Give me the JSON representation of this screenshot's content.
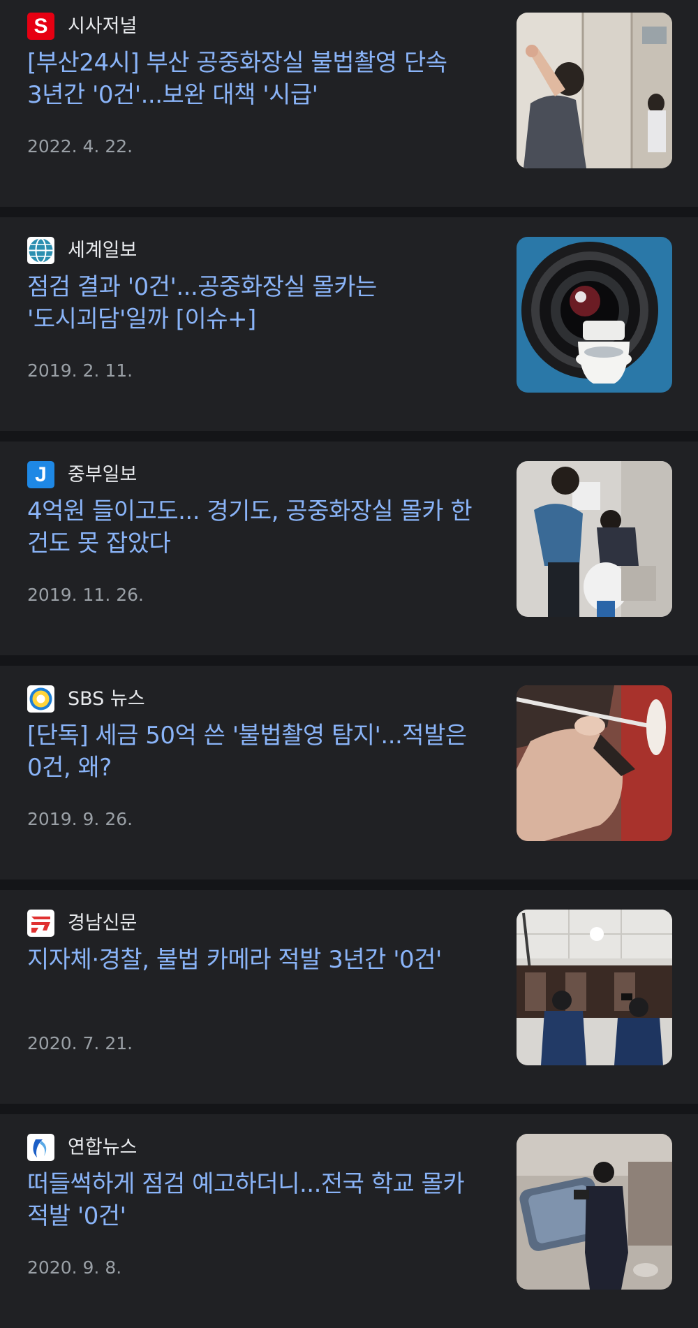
{
  "articles": [
    {
      "source": "시사저널",
      "headline": "[부산24시] 부산 공중화장실 불법촬영 단속 3년간 '0건'...보완 대책 '시급'",
      "date": "2022. 4. 22.",
      "logo": {
        "icon": "sisajournal-s-logo",
        "bg": "#e60012",
        "glyph": "S"
      },
      "thumbnail_icon": "restroom-stall-inspection-photo"
    },
    {
      "source": "세계일보",
      "headline": "점검 결과 '0건'...공중화장실 몰카는 '도시괴담'일까 [이슈+]",
      "date": "2019. 2. 11.",
      "logo": {
        "icon": "segye-globe-logo",
        "bg": "#2b8fb0"
      },
      "thumbnail_icon": "camera-lens-over-toilet-illustration"
    },
    {
      "source": "중부일보",
      "headline": "4억원 들이고도... 경기도, 공중화장실 몰카 한 건도 못 잡았다",
      "date": "2019. 11. 26.",
      "logo": {
        "icon": "joongboo-j-logo",
        "bg": "#1e88e5",
        "glyph": "J"
      },
      "thumbnail_icon": "officers-checking-toilet-photo"
    },
    {
      "source": "SBS 뉴스",
      "headline": "[단독] 세금 50억 쓴 '불법촬영 탐지'...적발은 0건, 왜?",
      "date": "2019. 9. 26.",
      "logo": {
        "icon": "sbs-ring-logo",
        "bg": "#ffffff"
      },
      "thumbnail_icon": "hand-holding-detector-photo"
    },
    {
      "source": "경남신문",
      "headline": "지자체·경찰, 불법 카메라 적발 3년간 '0건'",
      "date": "2020. 7. 21.",
      "logo": {
        "icon": "gyeongnam-red-logo",
        "bg": "#ffffff"
      },
      "thumbnail_icon": "police-inspecting-ceiling-photo"
    },
    {
      "source": "연합뉴스",
      "headline": "떠들썩하게 점검 예고하더니...전국 학교 몰카 적발 '0건'",
      "date": "2020. 9. 8.",
      "logo": {
        "icon": "yonhap-swoosh-logo",
        "bg": "#ffffff"
      },
      "thumbnail_icon": "man-with-smartphone-photo"
    }
  ],
  "colors": {
    "page_background": "#141518",
    "card_background": "#202124",
    "headline": "#8ab4f8",
    "source_text": "#e8eaed",
    "date_text": "#9aa0a6"
  }
}
